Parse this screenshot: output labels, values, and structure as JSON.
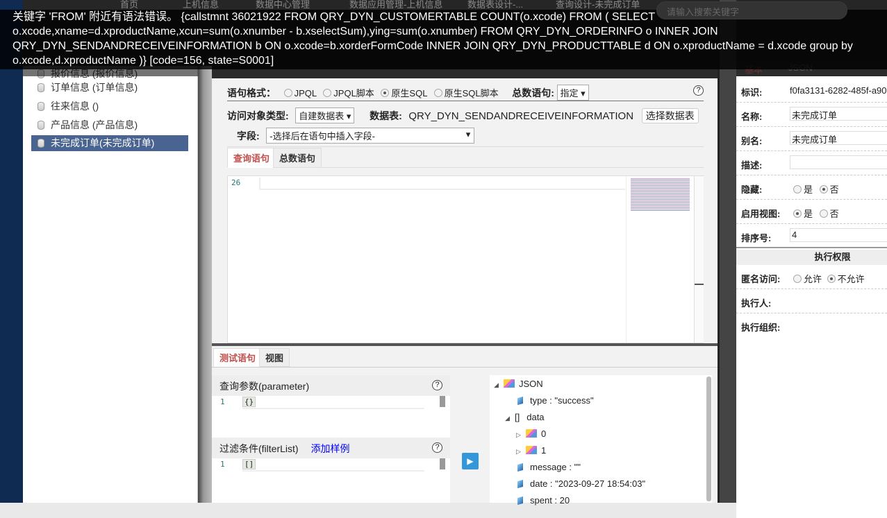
{
  "topbar": {
    "tabs": [
      "首页",
      "上机信息",
      "数据中心管理",
      "数据应用管理-上机信息",
      "数据表设计-...",
      "查询设计-未完成订单"
    ],
    "search_placeholder": "请输入搜索关键字"
  },
  "error": {
    "message": "关键字 'FROM' 附近有语法错误。 {callstmnt 36021922 FROM QRY_DYN_CUSTOMERTABLE COUNT(o.xcode) FROM ( SELECT o.xcode,xname=d.xproductName,xcun=sum(o.xnumber - b.xselectSum),ying=sum(o.xnumber) FROM QRY_DYN_ORDERINFO o INNER JOIN QRY_DYN_SENDANDRECEIVEINFORMATION b ON o.xcode=b.xorderFormCode INNER JOIN QRY_DYN_PRODUCTTABLE d ON o.xproductName = d.xcode group by o.xcode,d.xproductName )} [code=156, state=S0001]"
  },
  "list": {
    "items": [
      "报价信息 (报价信息)",
      "订单信息 (订单信息)",
      "往来信息 ()",
      "产品信息 (产品信息)",
      "未完成订单(未完成订单)"
    ],
    "selected": 4
  },
  "form": {
    "format_label": "语句格式：",
    "formats": [
      "JPQL",
      "JPQL脚本",
      "原生SQL",
      "原生SQL脚本"
    ],
    "format_selected": 2,
    "count_label": "总数语句:",
    "count_value": "指定",
    "access_label": "访问对象类型:",
    "access_value": "自建数据表",
    "table_label": "数据表:",
    "table_value": "QRY_DYN_SENDANDRECEIVEINFORMATION",
    "choose_table": "选择数据表",
    "field_label": "字段:",
    "field_placeholder": "-选择后在语句中插入字段-",
    "tabs": [
      "查询语句",
      "总数语句"
    ],
    "line_number": "26",
    "help": "?"
  },
  "test": {
    "tabs": [
      "测试语句",
      "视图"
    ],
    "param_title": "查询参数(parameter)",
    "param_line": "1",
    "param_value": "{}",
    "filter_title": "过滤条件(filterList)",
    "filter_add": "添加样例",
    "filter_line": "1",
    "filter_value": "[]"
  },
  "result": {
    "root": "JSON",
    "type": "type : \"success\"",
    "data_bracket": "[]",
    "data": "data",
    "items": [
      "0",
      "1"
    ],
    "message": "message : \"\"",
    "date": "date : \"2023-09-27 18:54:03\"",
    "spent": "spent : 20"
  },
  "props": {
    "tabs": [
      "基本",
      "JSON"
    ],
    "rows": [
      {
        "k": "标识:",
        "v": "f0fa3131-6282-485f-a90"
      },
      {
        "k": "名称:",
        "v": "未完成订单"
      },
      {
        "k": "别名:",
        "v": "未完成订单"
      },
      {
        "k": "描述:",
        "v": ""
      }
    ],
    "hidden_label": "隐藏:",
    "enable_view_label": "启用视图:",
    "yes": "是",
    "no": "否",
    "order_label": "排序号:",
    "order_value": "4",
    "exec_section": "执行权限",
    "anon_label": "匿名访问:",
    "allow": "允许",
    "deny": "不允许",
    "executor_label": "执行人:",
    "exec_org_label": "执行组织:"
  }
}
